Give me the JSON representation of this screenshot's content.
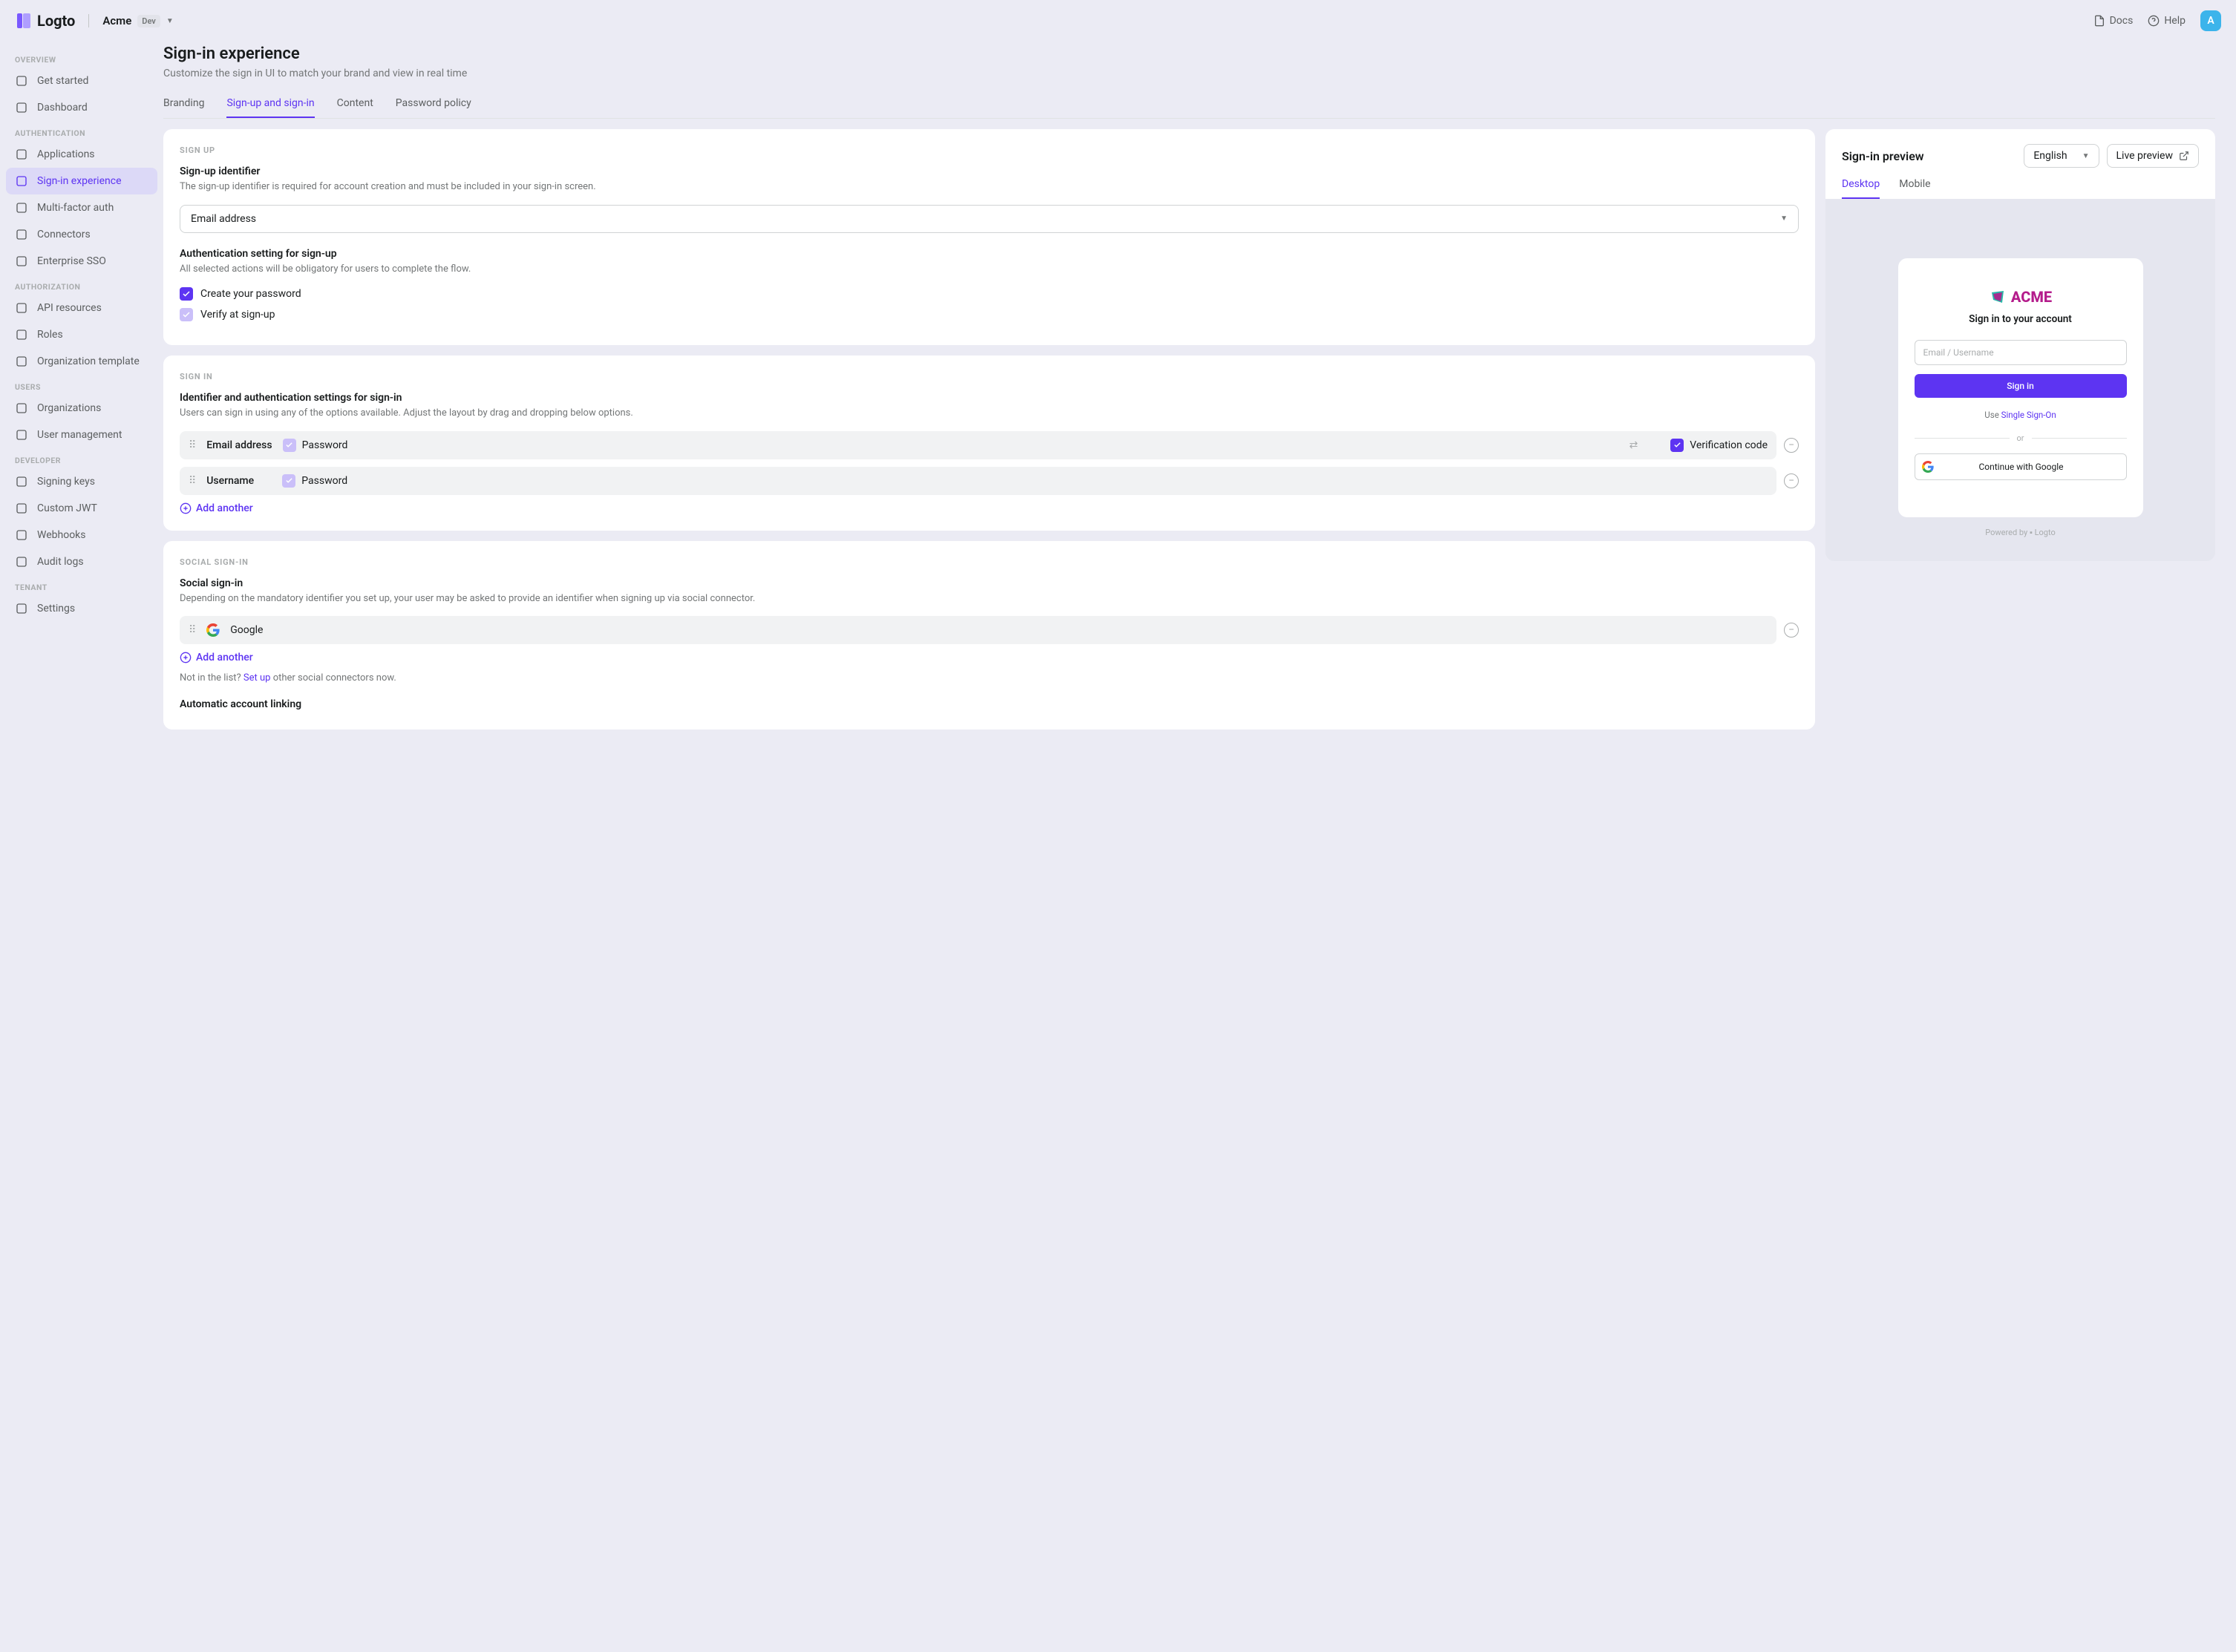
{
  "brand": "Logto",
  "tenant": {
    "name": "Acme",
    "env": "Dev"
  },
  "topbar": {
    "docs": "Docs",
    "help": "Help",
    "avatar_initial": "A"
  },
  "sidebar": {
    "groups": [
      {
        "label": "OVERVIEW",
        "items": [
          {
            "label": "Get started",
            "icon": "bolt-icon"
          },
          {
            "label": "Dashboard",
            "icon": "chart-icon"
          }
        ]
      },
      {
        "label": "AUTHENTICATION",
        "items": [
          {
            "label": "Applications",
            "icon": "box-icon"
          },
          {
            "label": "Sign-in experience",
            "icon": "signin-icon",
            "active": true
          },
          {
            "label": "Multi-factor auth",
            "icon": "lock-icon"
          },
          {
            "label": "Connectors",
            "icon": "plug-icon"
          },
          {
            "label": "Enterprise SSO",
            "icon": "sso-icon"
          }
        ]
      },
      {
        "label": "AUTHORIZATION",
        "items": [
          {
            "label": "API resources",
            "icon": "api-icon"
          },
          {
            "label": "Roles",
            "icon": "user-box-icon"
          },
          {
            "label": "Organization template",
            "icon": "org-template-icon"
          }
        ]
      },
      {
        "label": "USERS",
        "items": [
          {
            "label": "Organizations",
            "icon": "org-icon"
          },
          {
            "label": "User management",
            "icon": "user-icon"
          }
        ]
      },
      {
        "label": "DEVELOPER",
        "items": [
          {
            "label": "Signing keys",
            "icon": "key-icon"
          },
          {
            "label": "Custom JWT",
            "icon": "gear-icon"
          },
          {
            "label": "Webhooks",
            "icon": "hook-icon"
          },
          {
            "label": "Audit logs",
            "icon": "list-icon"
          }
        ]
      },
      {
        "label": "TENANT",
        "items": [
          {
            "label": "Settings",
            "icon": "gear-icon"
          }
        ]
      }
    ]
  },
  "page": {
    "title": "Sign-in experience",
    "subtitle": "Customize the sign in UI to match your brand and view in real time",
    "tabs": [
      "Branding",
      "Sign-up and sign-in",
      "Content",
      "Password policy"
    ],
    "active_tab": 1
  },
  "signup": {
    "eyebrow": "SIGN UP",
    "identifier_title": "Sign-up identifier",
    "identifier_help": "The sign-up identifier is required for account creation and must be included in your sign-in screen.",
    "identifier_value": "Email address",
    "auth_title": "Authentication setting for sign-up",
    "auth_help": "All selected actions will be obligatory for users to complete the flow.",
    "checks": [
      {
        "label": "Create your password",
        "state": "on"
      },
      {
        "label": "Verify at sign-up",
        "state": "locked"
      }
    ]
  },
  "signin": {
    "eyebrow": "SIGN IN",
    "title": "Identifier and authentication settings for sign-in",
    "help": "Users can sign in using any of the options available. Adjust the layout by drag and dropping below options.",
    "rows": [
      {
        "identifier": "Email address",
        "password_state": "locked",
        "password_label": "Password",
        "has_swap": true,
        "verification_state": "on",
        "verification_label": "Verification code"
      },
      {
        "identifier": "Username",
        "password_state": "locked",
        "password_label": "Password"
      }
    ],
    "add": "Add another"
  },
  "social": {
    "eyebrow": "SOCIAL SIGN-IN",
    "title": "Social sign-in",
    "help": "Depending on the mandatory identifier you set up, your user may be asked to provide an identifier when signing up via social connector.",
    "items": [
      {
        "name": "Google"
      }
    ],
    "add": "Add another",
    "not_in_list_prefix": "Not in the list? ",
    "setup_link": "Set up",
    "not_in_list_suffix": " other social connectors now.",
    "auto_link_title": "Automatic account linking"
  },
  "preview": {
    "title": "Sign-in preview",
    "language": "English",
    "live_preview": "Live preview",
    "tabs": [
      "Desktop",
      "Mobile"
    ],
    "active_tab": 0,
    "app": {
      "brand": "ACME",
      "heading": "Sign in to your account",
      "placeholder": "Email / Username",
      "signin_btn": "Sign in",
      "sso_prefix": "Use ",
      "sso_link": "Single Sign-On",
      "or": "or",
      "google": "Continue with Google",
      "powered_prefix": "Powered by ",
      "powered_brand": "Logto"
    }
  }
}
